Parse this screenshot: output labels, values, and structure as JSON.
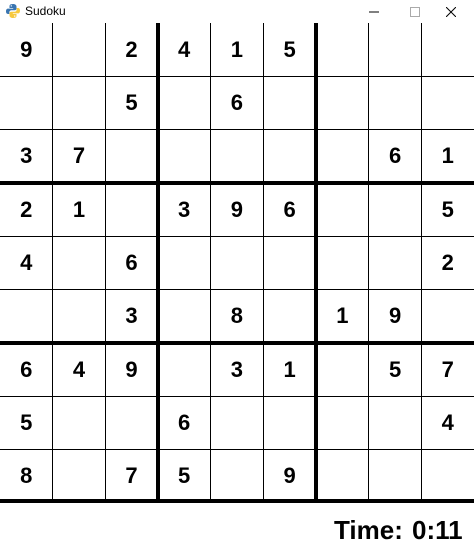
{
  "window": {
    "title": "Sudoku",
    "icon": "python-snake-icon",
    "controls": [
      "minimize",
      "maximize",
      "close"
    ]
  },
  "grid": [
    [
      "9",
      "",
      "2",
      "4",
      "1",
      "5",
      "",
      "",
      ""
    ],
    [
      "",
      "",
      "5",
      "",
      "6",
      "",
      "",
      "",
      ""
    ],
    [
      "3",
      "7",
      "",
      "",
      "",
      "",
      "",
      "6",
      "1"
    ],
    [
      "2",
      "1",
      "",
      "3",
      "9",
      "6",
      "",
      "",
      "5"
    ],
    [
      "4",
      "",
      "6",
      "",
      "",
      "",
      "",
      "",
      "2"
    ],
    [
      "",
      "",
      "3",
      "",
      "8",
      "",
      "1",
      "9",
      ""
    ],
    [
      "6",
      "4",
      "9",
      "",
      "3",
      "1",
      "",
      "5",
      "7"
    ],
    [
      "5",
      "",
      "",
      "6",
      "",
      "",
      "",
      "",
      "4"
    ],
    [
      "8",
      "",
      "7",
      "5",
      "",
      "9",
      "",
      "",
      ""
    ]
  ],
  "timer": {
    "label": "Time:",
    "value": "0:11"
  },
  "colors": {
    "grid_line": "#000000",
    "background": "#ffffff",
    "digit": "#000000"
  }
}
